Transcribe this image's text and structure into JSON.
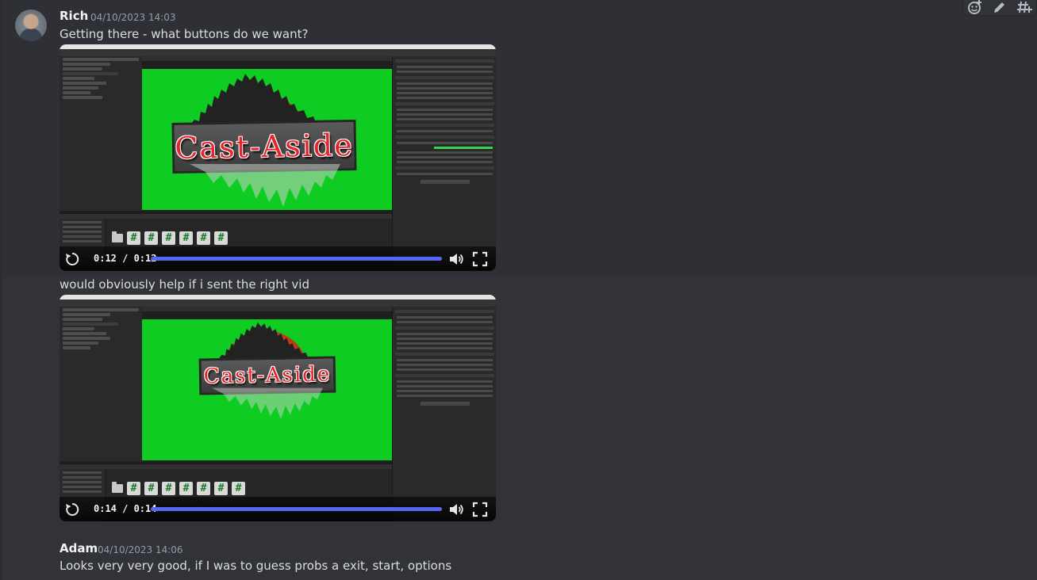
{
  "messages": [
    {
      "author": "Rich",
      "timestamp": "04/10/2023 14:03",
      "text": "Getting there - what buttons do we want?",
      "video": {
        "logo_text": "Cast-Aside",
        "time": "0:12 / 0:12",
        "progress": 1.0
      }
    },
    {
      "text": "would obviously help if i sent the right vid",
      "video": {
        "logo_text": "Cast-Aside",
        "time": "0:14 / 0:14",
        "progress": 1.0
      }
    },
    {
      "author": "Adam",
      "timestamp": "04/10/2023 14:06",
      "text": "Looks very very good, if I was to guess probs a exit, start, options"
    }
  ],
  "toolbar": {
    "icons": [
      "add-reaction-icon",
      "edit-icon",
      "create-thread-icon"
    ]
  },
  "video_controls": {
    "icons": [
      "replay-icon",
      "volume-icon",
      "fullscreen-icon"
    ],
    "accent": "#5865f2"
  },
  "colors": {
    "background": "#313338",
    "author": "#f2f3f5",
    "timestamp": "#949ba4",
    "text": "#dbdee1",
    "chroma_green": "#0fcc22"
  }
}
